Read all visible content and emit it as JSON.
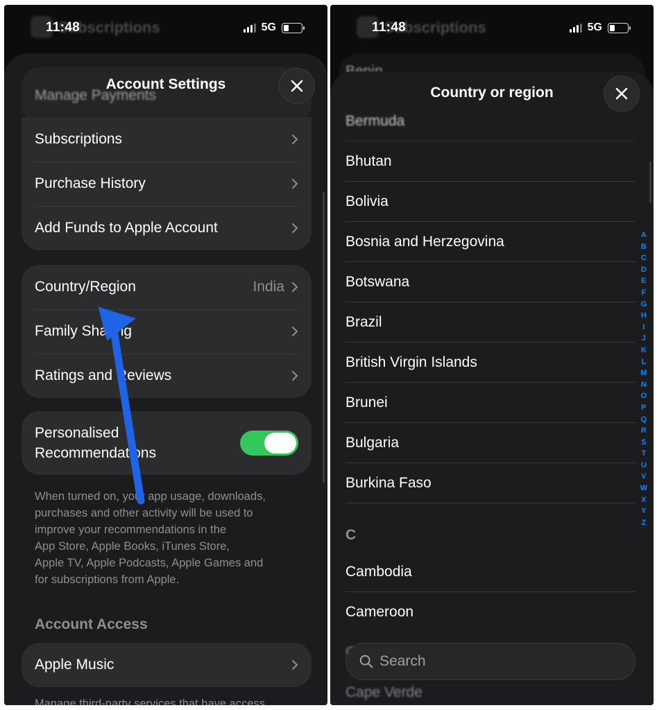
{
  "left": {
    "status": {
      "time": "11:48",
      "network": "5G"
    },
    "ghost_title": "Subscriptions",
    "sheet_title": "Account Settings",
    "partial_row": "Manage Payments",
    "group1": [
      {
        "label": "Subscriptions"
      },
      {
        "label": "Purchase History"
      },
      {
        "label": "Add Funds to Apple Account"
      }
    ],
    "group2": [
      {
        "label": "Country/Region",
        "value": "India"
      },
      {
        "label": "Family Sharing"
      },
      {
        "label": "Ratings and Reviews"
      }
    ],
    "recommendations": {
      "label_line1": "Personalised",
      "label_line2": "Recommendations",
      "enabled": true
    },
    "recommendations_note_lines": [
      "When turned on, your app usage, downloads,",
      "purchases and other activity will be used to",
      "improve your recommendations in the",
      "App Store, Apple Books, iTunes Store,",
      "Apple TV, Apple Podcasts, Apple Games and",
      "for subscriptions from Apple."
    ],
    "account_access_header": "Account Access",
    "apple_music": "Apple Music",
    "account_access_note": "Manage third-party services that have access"
  },
  "right": {
    "status": {
      "time": "11:48",
      "network": "5G"
    },
    "ghost_title": "Subscriptions",
    "ghost_row": "Benin",
    "sheet_title": "Country or region",
    "countries": [
      "Bermuda",
      "Bhutan",
      "Bolivia",
      "Bosnia and Herzegovina",
      "Botswana",
      "Brazil",
      "British Virgin Islands",
      "Brunei",
      "Bulgaria",
      "Burkina Faso"
    ],
    "section_c": "C",
    "countries_c": [
      "Cambodia",
      "Cameroon"
    ],
    "partial_bottom": [
      "Canada",
      "Cape Verde"
    ],
    "search_placeholder": "Search",
    "index_letters": [
      "A",
      "B",
      "C",
      "D",
      "E",
      "F",
      "G",
      "H",
      "I",
      "J",
      "K",
      "L",
      "M",
      "N",
      "O",
      "P",
      "Q",
      "R",
      "S",
      "T",
      "U",
      "V",
      "W",
      "X",
      "Y",
      "Z"
    ]
  },
  "colors": {
    "accent_blue": "#0a84ff",
    "toggle_green": "#34c759",
    "annotation_arrow": "#1f63e6"
  },
  "icons": {
    "close": "close-icon",
    "chevron": "chevron-right-icon",
    "search": "search-icon"
  }
}
